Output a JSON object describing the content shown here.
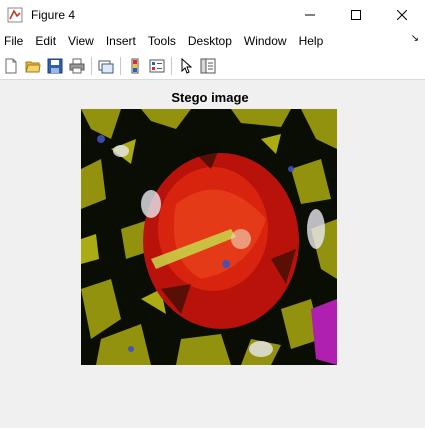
{
  "window": {
    "title": "Figure 4",
    "app_icon": "matlab-figure-icon",
    "controls": [
      "minimize-icon",
      "maximize-icon",
      "close-icon"
    ]
  },
  "menubar": {
    "items": [
      "File",
      "Edit",
      "View",
      "Insert",
      "Tools",
      "Desktop",
      "Window",
      "Help"
    ],
    "dock_glyph": "↘"
  },
  "toolbar": {
    "buttons": [
      "new-figure-icon",
      "open-file-icon",
      "save-icon",
      "print-icon",
      "link-plot-icon",
      "insert-colorbar-icon",
      "insert-legend-icon",
      "edit-plot-arrow-icon",
      "property-inspector-icon"
    ]
  },
  "axes": {
    "title": "Stego image"
  },
  "colors": {
    "titlebar_bg": "#ffffff",
    "figure_bg": "#f0f0f0",
    "image_dark": "#0a0d03",
    "image_red": "#c8140a",
    "image_olive": "#9a9a10",
    "image_magenta": "#b020b0"
  }
}
